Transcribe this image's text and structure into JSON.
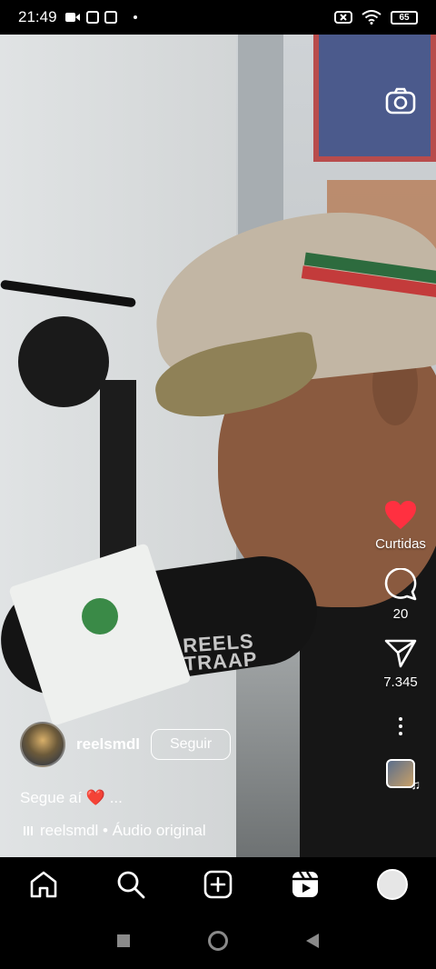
{
  "status_bar": {
    "time": "21:49",
    "battery": "65"
  },
  "reel": {
    "watermark": "REELS\nTRAAP",
    "username": "reelsmdl",
    "follow_label": "Seguir",
    "caption_text": "Segue aí",
    "caption_suffix": "...",
    "audio_label": "reelsmdl • Áudio original"
  },
  "actions": {
    "like_label": "Curtidas",
    "comments_count": "20",
    "shares_count": "7.345"
  },
  "nav": {
    "items": [
      "home-icon",
      "search-icon",
      "create-icon",
      "reels-icon",
      "profile-icon"
    ]
  },
  "colors": {
    "like_red": "#ff3040",
    "background": "#000000"
  }
}
